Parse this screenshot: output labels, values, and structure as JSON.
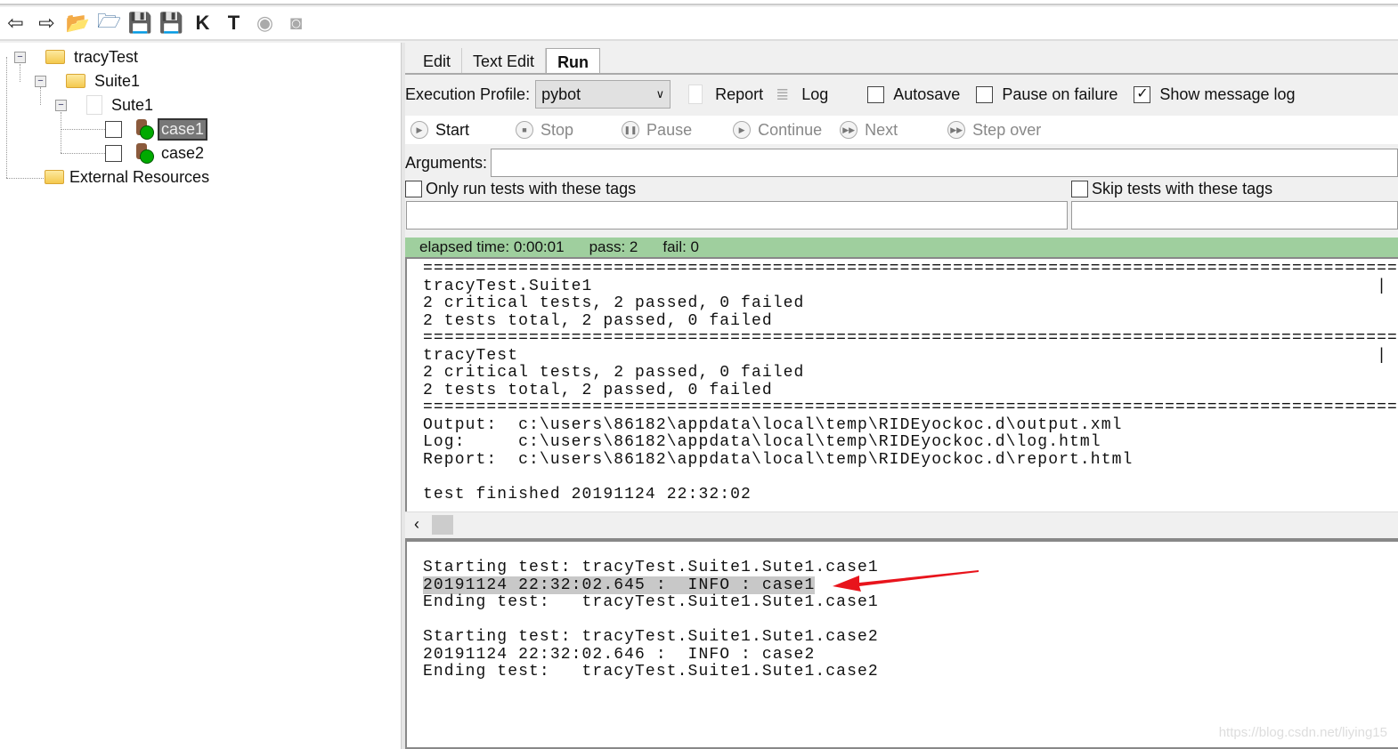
{
  "toolbar": {
    "icons": [
      "back-arrow-icon",
      "forward-arrow-icon",
      "open-directory-icon",
      "open-folder-icon",
      "save-icon",
      "save-all-icon",
      "search-keywords-icon",
      "search-tests-icon",
      "run-icon",
      "stop-icon"
    ]
  },
  "tree": {
    "root": "tracyTest",
    "suite": "Suite1",
    "file": "Sute1",
    "cases": [
      "case1",
      "case2"
    ],
    "selected": "case1",
    "external": "External Resources"
  },
  "tabs": [
    "Edit",
    "Text Edit",
    "Run"
  ],
  "active_tab": "Run",
  "run": {
    "profile_label": "Execution Profile:",
    "profile_value": "pybot",
    "report": "Report",
    "log": "Log",
    "autosave": {
      "label": "Autosave",
      "checked": false
    },
    "pause_on_failure": {
      "label": "Pause on failure",
      "checked": false
    },
    "show_message_log": {
      "label": "Show message log",
      "checked": true
    },
    "buttons": [
      "Start",
      "Stop",
      "Pause",
      "Continue",
      "Next",
      "Step over"
    ],
    "arguments_label": "Arguments:",
    "arguments_value": "",
    "only_tags": {
      "label": "Only run tests with these tags",
      "checked": false
    },
    "skip_tags": {
      "label": "Skip tests with these tags",
      "checked": false
    }
  },
  "status": {
    "elapsed": "elapsed time: 0:00:01",
    "pass": "pass: 2",
    "fail": "fail: 0",
    "color": "#9fcf9e"
  },
  "console_lines": [
    "==============================================================================================",
    "tracyTest.Suite1                                                                          |",
    "2 critical tests, 2 passed, 0 failed",
    "2 tests total, 2 passed, 0 failed",
    "==============================================================================================",
    "tracyTest                                                                                 |",
    "2 critical tests, 2 passed, 0 failed",
    "2 tests total, 2 passed, 0 failed",
    "==============================================================================================",
    "Output:  c:\\users\\86182\\appdata\\local\\temp\\RIDEyockoc.d\\output.xml",
    "Log:     c:\\users\\86182\\appdata\\local\\temp\\RIDEyockoc.d\\log.html",
    "Report:  c:\\users\\86182\\appdata\\local\\temp\\RIDEyockoc.d\\report.html",
    "",
    "test finished 20191124 22:32:02"
  ],
  "message_log": [
    "Starting test: tracyTest.Suite1.Sute1.case1",
    "20191124 22:32:02.645 :  INFO : case1",
    "Ending test:   tracyTest.Suite1.Sute1.case1",
    "",
    "Starting test: tracyTest.Suite1.Sute1.case2",
    "20191124 22:32:02.646 :  INFO : case2",
    "Ending test:   tracyTest.Suite1.Sute1.case2"
  ],
  "watermark": "https://blog.csdn.net/liying15"
}
